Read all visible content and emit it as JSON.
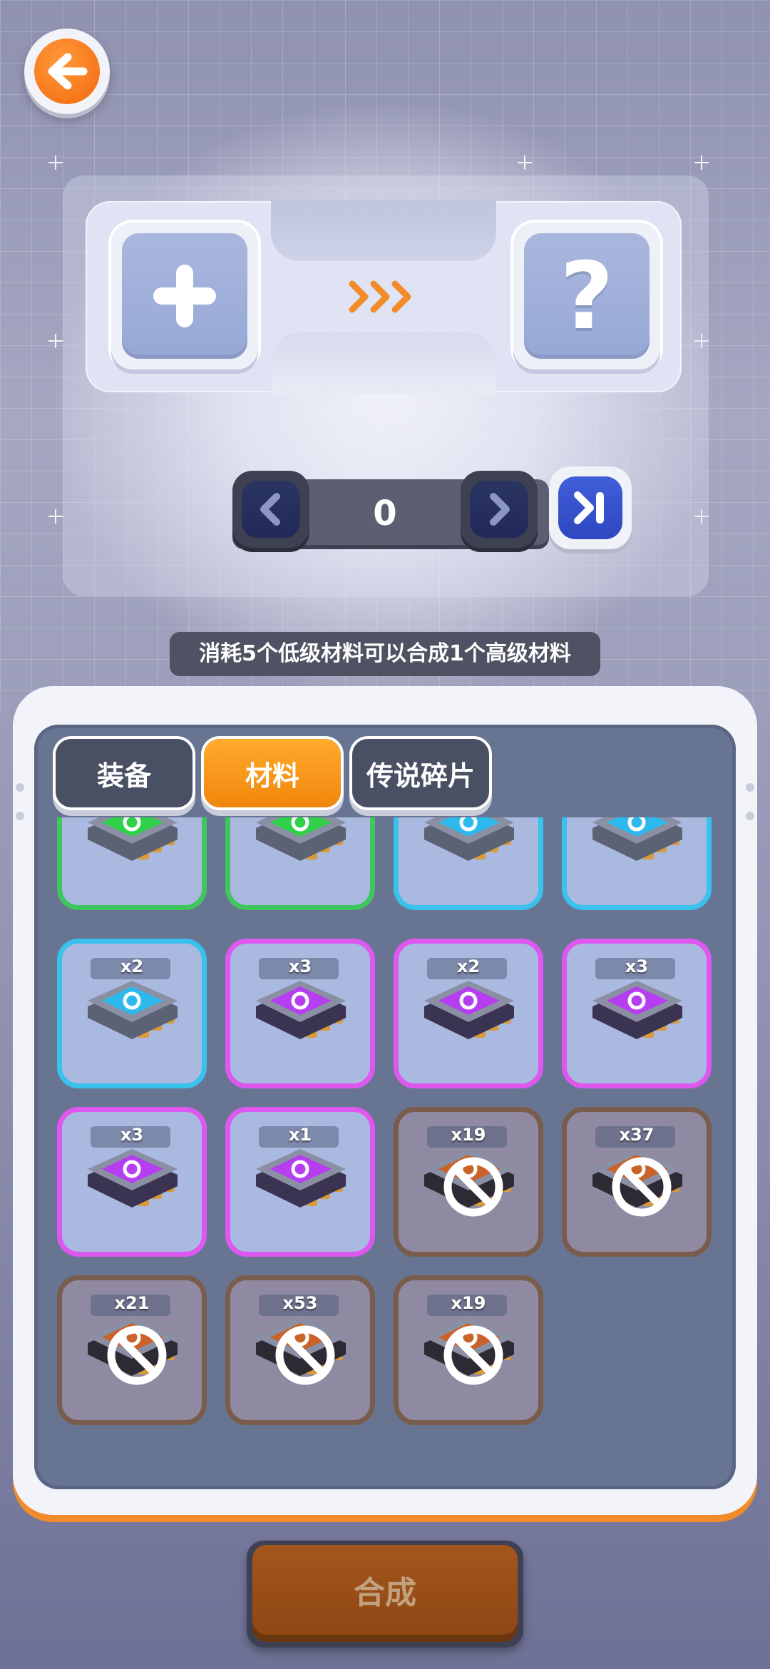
{
  "top": {
    "back_icon": "arrow-left-icon",
    "input_slot_icon": "plus-icon",
    "output_slot_icon": "question-icon",
    "output_slot_text": "?",
    "arrows_icon": "triple-chevron-right-icon"
  },
  "stepper": {
    "value": "0",
    "decrease_icon": "chevron-left-icon",
    "increase_icon": "chevron-right-icon",
    "max_icon": "skip-to-end-icon"
  },
  "hint": "消耗5个低级材料可以合成1个高级材料",
  "tabs": [
    {
      "label": "装备",
      "active": false
    },
    {
      "label": "材料",
      "active": true
    },
    {
      "label": "传说碎片",
      "active": false
    }
  ],
  "items": [
    {
      "rarity": "green",
      "icon": "chip-eye-icon",
      "count": ""
    },
    {
      "rarity": "green",
      "icon": "chip-helmet-icon",
      "count": ""
    },
    {
      "rarity": "blue",
      "icon": "chip-gear-icon",
      "count": ""
    },
    {
      "rarity": "blue",
      "icon": "chip-boot-icon",
      "count": ""
    },
    {
      "rarity": "blue",
      "icon": "chip-helmet-icon",
      "count": "x2"
    },
    {
      "rarity": "purple",
      "icon": "chip-armor-icon",
      "count": "x3"
    },
    {
      "rarity": "purple",
      "icon": "chip-gear-icon",
      "count": "x2"
    },
    {
      "rarity": "purple",
      "icon": "chip-eye-icon",
      "count": "x3"
    },
    {
      "rarity": "purple",
      "icon": "chip-boot-icon",
      "count": "x3"
    },
    {
      "rarity": "purple",
      "icon": "chip-helmet-icon",
      "count": "x1"
    },
    {
      "rarity": "locked",
      "icon": "chip-locked-icon",
      "count": "x19"
    },
    {
      "rarity": "locked",
      "icon": "chip-locked-icon",
      "count": "x37"
    },
    {
      "rarity": "locked",
      "icon": "chip-locked-icon",
      "count": "x21"
    },
    {
      "rarity": "locked",
      "icon": "chip-locked-icon",
      "count": "x53"
    },
    {
      "rarity": "locked",
      "icon": "chip-locked-icon",
      "count": "x19"
    }
  ],
  "synth_button": "合成",
  "colors": {
    "accent": "#f28c2a",
    "green": "#3fc65f",
    "blue": "#38c2ec",
    "purple": "#de58f0",
    "locked": "#7a5c4c"
  }
}
